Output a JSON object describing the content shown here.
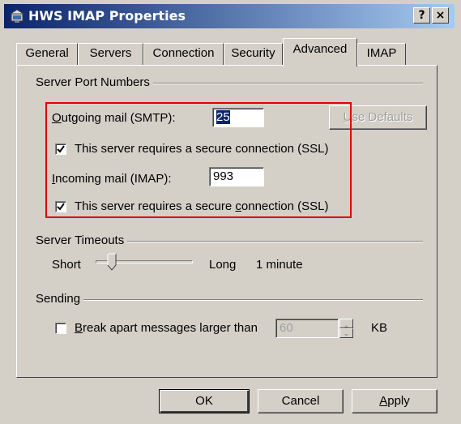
{
  "window": {
    "title": "HWS IMAP Properties",
    "help_label": "?",
    "close_label": "×"
  },
  "tabs": [
    {
      "label": "General"
    },
    {
      "label": "Servers"
    },
    {
      "label": "Connection"
    },
    {
      "label": "Security"
    },
    {
      "label": "Advanced"
    },
    {
      "label": "IMAP"
    }
  ],
  "port_group": {
    "label": "Server Port Numbers",
    "outgoing_label_mn": "O",
    "outgoing_label_rest": "utgoing mail (SMTP):",
    "outgoing_value": "25",
    "use_defaults_mn": "U",
    "use_defaults_rest": "se Defaults",
    "ssl_label": "This server requires a secure connection (SSL)",
    "incoming_label_mn": "I",
    "incoming_label_rest": "ncoming mail (IMAP):",
    "incoming_value": "993",
    "ssl2_label_a": "This server requires a secure ",
    "ssl2_label_mn": "c",
    "ssl2_label_b": "onnection (SSL)"
  },
  "timeouts_group": {
    "label": "Server Timeouts",
    "short_label": "Short",
    "long_label": "Long",
    "value_text": "1 minute"
  },
  "sending_group": {
    "label": "Sending",
    "break_label_mn": "B",
    "break_label_rest": "reak apart messages larger than",
    "size_value": "60",
    "unit_label": "KB"
  },
  "buttons": {
    "ok_label": "OK",
    "cancel_label": "Cancel",
    "apply_mn": "A",
    "apply_rest": "pply"
  },
  "colors": {
    "title_gradient_start": "#0a246a",
    "title_gradient_end": "#a6caf0",
    "highlight_box": "#e00000",
    "face": "#d4d0c8"
  }
}
